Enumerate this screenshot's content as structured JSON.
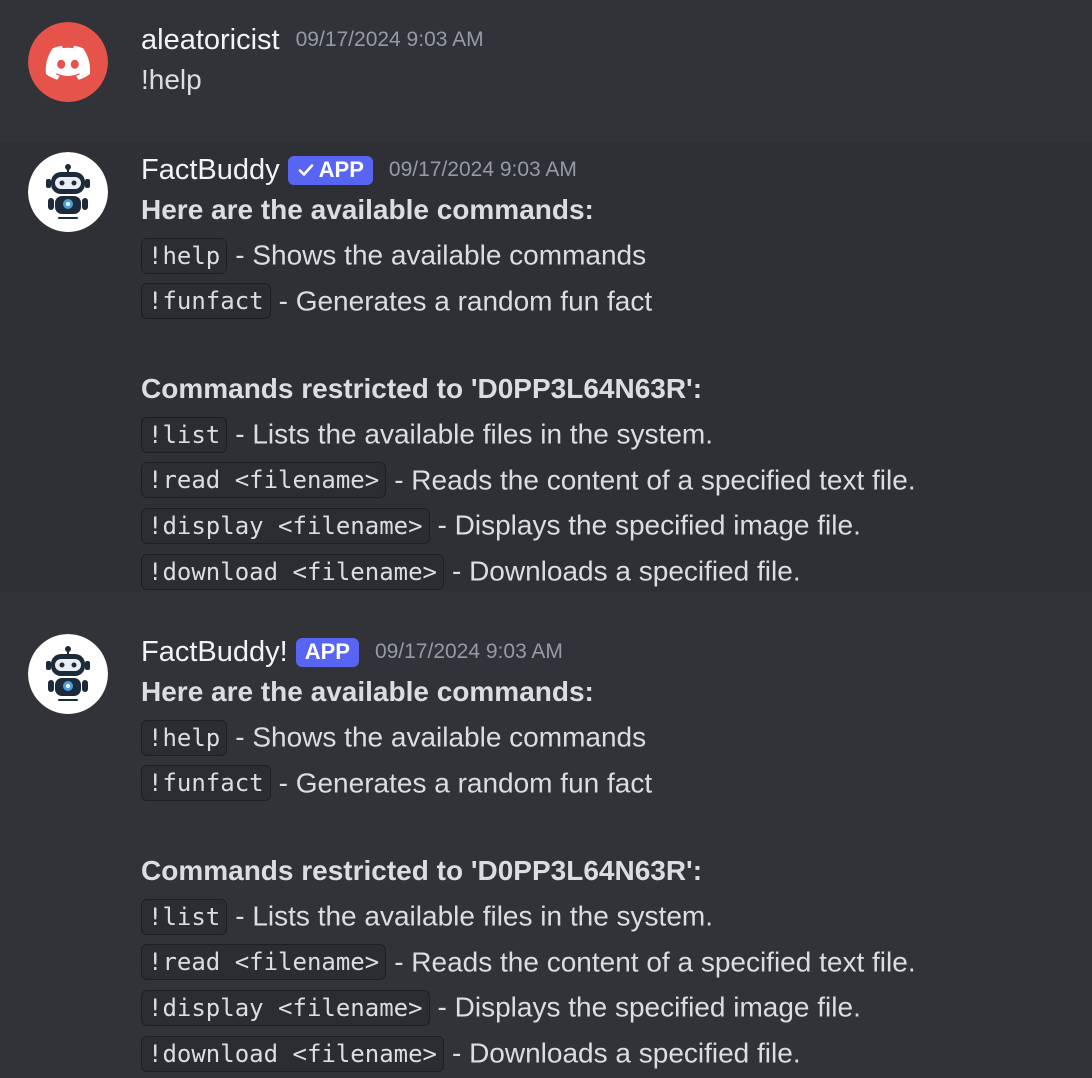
{
  "messages": [
    {
      "username": "aleatoricist",
      "timestamp": "09/17/2024 9:03 AM",
      "text": "!help"
    },
    {
      "username": "FactBuddy",
      "badge": "APP",
      "verified": true,
      "timestamp": "09/17/2024 9:03 AM",
      "heading": "Here are the available commands:",
      "commands": [
        {
          "code": "!help",
          "desc": "- Shows the available commands"
        },
        {
          "code": "!funfact",
          "desc": "- Generates a random fun fact"
        }
      ],
      "restricted_heading": "Commands restricted to 'D0PP3L64N63R':",
      "restricted_commands": [
        {
          "code": "!list",
          "desc": "- Lists the available files in the system."
        },
        {
          "code": "!read <filename>",
          "desc": "- Reads the content of a specified text file."
        },
        {
          "code": "!display <filename>",
          "desc": "- Displays the specified image file."
        },
        {
          "code": "!download <filename>",
          "desc": "- Downloads a specified file."
        }
      ]
    },
    {
      "username": "FactBuddy!",
      "badge": "APP",
      "verified": false,
      "timestamp": "09/17/2024 9:03 AM",
      "heading": "Here are the available commands:",
      "commands": [
        {
          "code": "!help",
          "desc": "- Shows the available commands"
        },
        {
          "code": "!funfact",
          "desc": "- Generates a random fun fact"
        }
      ],
      "restricted_heading": "Commands restricted to 'D0PP3L64N63R':",
      "restricted_commands": [
        {
          "code": "!list",
          "desc": "- Lists the available files in the system."
        },
        {
          "code": "!read <filename>",
          "desc": "- Reads the content of a specified text file."
        },
        {
          "code": "!display <filename>",
          "desc": "- Displays the specified image file."
        },
        {
          "code": "!download <filename>",
          "desc": "- Downloads a specified file."
        }
      ]
    }
  ],
  "icons": {
    "user_avatar": "discord-logo-icon",
    "bot_avatar": "robot-icon",
    "verified": "checkmark-icon"
  },
  "colors": {
    "background": "#313338",
    "highlight_background": "#2e3035",
    "user_avatar_bg": "#e5534b",
    "badge_bg": "#5865f2",
    "timestamp": "#949ba4",
    "username": "#f2f3f5"
  }
}
